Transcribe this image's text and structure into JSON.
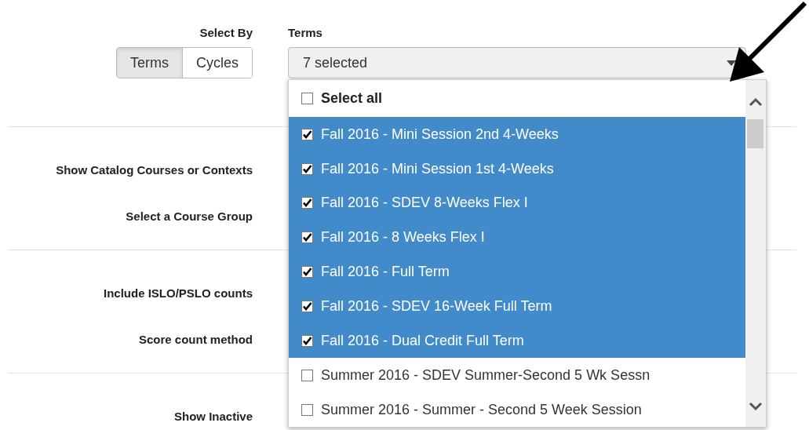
{
  "select_by": {
    "label": "Select By",
    "options": [
      {
        "label": "Terms",
        "selected": true
      },
      {
        "label": "Cycles",
        "selected": false
      }
    ]
  },
  "terms": {
    "label": "Terms",
    "value": "7 selected",
    "expanded": true,
    "select_all": {
      "label": "Select all",
      "checked": false
    },
    "items": [
      {
        "label": "Fall 2016 - Mini Session 2nd 4-Weeks",
        "checked": true
      },
      {
        "label": "Fall 2016 - Mini Session 1st 4-Weeks",
        "checked": true
      },
      {
        "label": "Fall 2016 - SDEV 8-Weeks Flex I",
        "checked": true
      },
      {
        "label": "Fall 2016 - 8 Weeks Flex I",
        "checked": true
      },
      {
        "label": "Fall 2016 - Full Term",
        "checked": true
      },
      {
        "label": "Fall 2016 - SDEV 16-Week Full Term",
        "checked": true
      },
      {
        "label": "Fall 2016 - Dual Credit Full Term",
        "checked": true
      },
      {
        "label": "Summer 2016 - SDEV Summer-Second 5 Wk Sessn",
        "checked": false
      },
      {
        "label": "Summer 2016 - Summer - Second 5 Week Session",
        "checked": false
      }
    ]
  },
  "sections": [
    {
      "rows": [
        {
          "label": "Show Catalog Courses or Contexts"
        },
        {
          "label": "Select a Course Group"
        }
      ]
    },
    {
      "rows": [
        {
          "label": "Include ISLO/PSLO counts"
        },
        {
          "label": "Score count method"
        }
      ]
    },
    {
      "rows": [
        {
          "label": "Show Inactive"
        }
      ]
    }
  ]
}
